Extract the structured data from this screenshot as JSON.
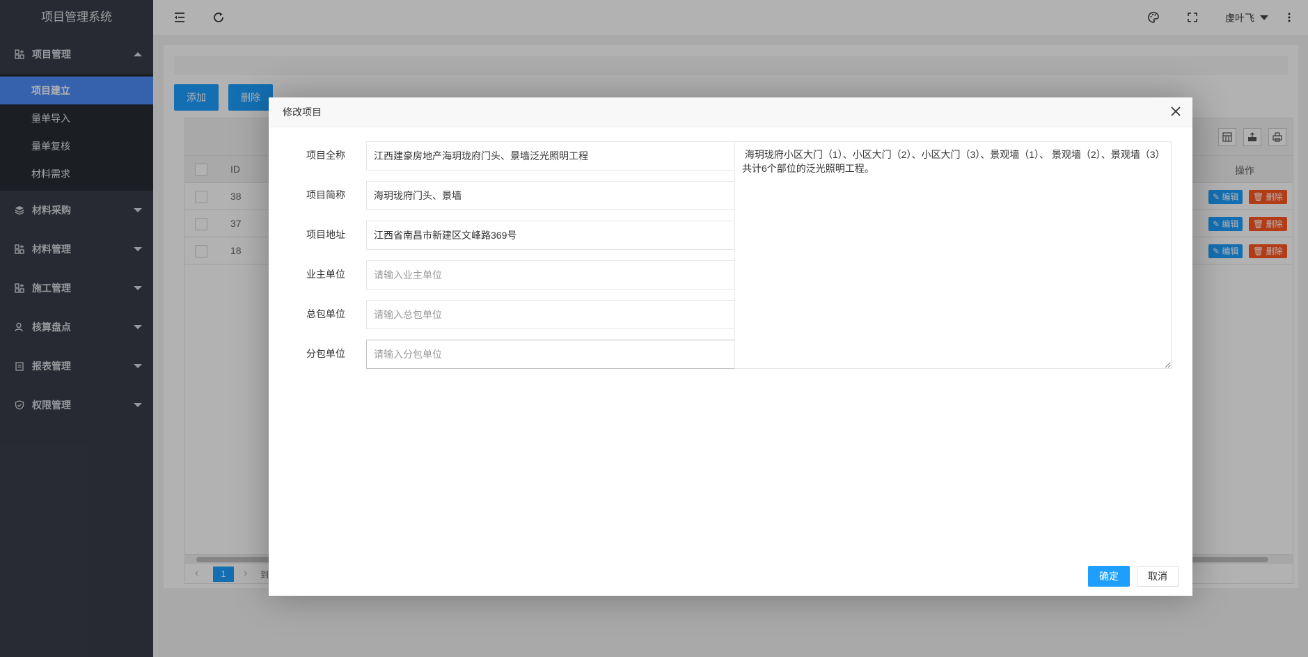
{
  "app": {
    "title": "项目管理系统"
  },
  "sidebar": {
    "groups": [
      {
        "label": "项目管理",
        "icon": "grid-icon",
        "expanded": true,
        "items": [
          {
            "label": "项目建立",
            "active": true
          },
          {
            "label": "量单导入"
          },
          {
            "label": "量单复核"
          },
          {
            "label": "材料需求"
          }
        ]
      },
      {
        "label": "材料采购",
        "icon": "layers-icon"
      },
      {
        "label": "材料管理",
        "icon": "grid-icon"
      },
      {
        "label": "施工管理",
        "icon": "grid-icon"
      },
      {
        "label": "核算盘点",
        "icon": "user-icon"
      },
      {
        "label": "报表管理",
        "icon": "clipboard-icon"
      },
      {
        "label": "权限管理",
        "icon": "shield-icon"
      }
    ]
  },
  "header": {
    "icons": [
      "menu-fold-icon",
      "refresh-icon",
      "palette-icon",
      "fullscreen-icon",
      "more-vertical-icon"
    ],
    "user": "虔叶飞"
  },
  "content": {
    "add_label": "添加",
    "delete_label": "删除",
    "table": {
      "columns": [
        "ID",
        "操作"
      ],
      "rows": [
        {
          "id": "38"
        },
        {
          "id": "37"
        },
        {
          "id": "18"
        }
      ],
      "edit_label": "编辑",
      "delete_label": "删除"
    },
    "pager": {
      "current": "1",
      "goto": "到第"
    }
  },
  "modal": {
    "title": "修改项目",
    "fields": [
      {
        "label": "项目全称",
        "value": "江西建豪房地产海玥珑府门头、景墙泛光照明工程",
        "placeholder": ""
      },
      {
        "label": "项目简称",
        "value": "海玥珑府门头、景墙",
        "placeholder": ""
      },
      {
        "label": "项目地址",
        "value": "江西省南昌市新建区文峰路369号",
        "placeholder": ""
      },
      {
        "label": "业主单位",
        "value": "",
        "placeholder": "请输入业主单位"
      },
      {
        "label": "总包单位",
        "value": "",
        "placeholder": "请输入总包单位"
      },
      {
        "label": "分包单位",
        "value": "",
        "placeholder": "请输入分包单位"
      }
    ],
    "description": " 海玥珑府小区大门（1）、小区大门（2）、小区大门（3）、景观墙（1）、 景观墙（2）、景观墙（3）共计6个部位的泛光照明工程。",
    "confirm_label": "确定",
    "cancel_label": "取消"
  },
  "colors": {
    "accent": "#1e9fff",
    "sidebar": "#393d49",
    "active": "#4e8cf7",
    "danger": "#ff5722"
  }
}
